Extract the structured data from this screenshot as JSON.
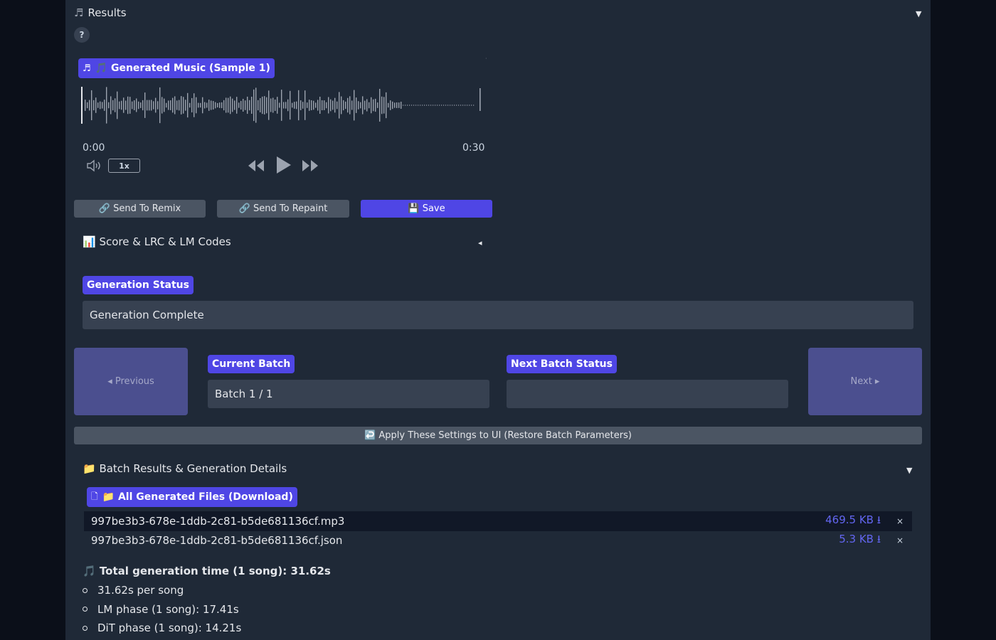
{
  "results": {
    "icon": "music-note-icon",
    "title": "Results",
    "help": "?"
  },
  "audio": {
    "label_icon": "music-note-icon",
    "label": "🎵 Generated Music (Sample 1)",
    "time_start": "0:00",
    "time_end": "0:30",
    "speed": "1x",
    "current_fraction": 0
  },
  "actions": {
    "remix": "🔗 Send To Remix",
    "repaint": "🔗 Send To Repaint",
    "save": "💾 Save"
  },
  "score_section": {
    "title": "📊 Score & LRC & LM Codes"
  },
  "generation_status": {
    "label": "Generation Status",
    "value": "Generation Complete"
  },
  "batch": {
    "previous": "◂ Previous",
    "next": "Next ▸",
    "current_label": "Current Batch",
    "current_value": "Batch 1 / 1",
    "next_status_label": "Next Batch Status",
    "next_status_value": ""
  },
  "apply_button": "↩️ Apply These Settings to UI (Restore Batch Parameters)",
  "batch_details": {
    "title": "📁 Batch Results & Generation Details",
    "files_label_icon": "file-icon",
    "files_label": "📁 All Generated Files (Download)",
    "files": [
      {
        "name": "997be3b3-678e-1ddb-2c81-b5de681136cf.mp3",
        "size": "469.5 KB ⭳",
        "remove": "×"
      },
      {
        "name": "997be3b3-678e-1ddb-2c81-b5de681136cf.json",
        "size": "5.3 KB ⭳",
        "remove": "×"
      }
    ]
  },
  "stats": {
    "headline": "🎵 Total generation time (1 song): 31.62s",
    "items": [
      "31.62s per song",
      "LM phase (1 song): 17.41s",
      "DiT phase (1 song): 14.21s"
    ]
  },
  "colors": {
    "accent": "#4f46e5",
    "panel": "#1f2937",
    "background": "#0b0f19",
    "link": "#6366f1"
  }
}
